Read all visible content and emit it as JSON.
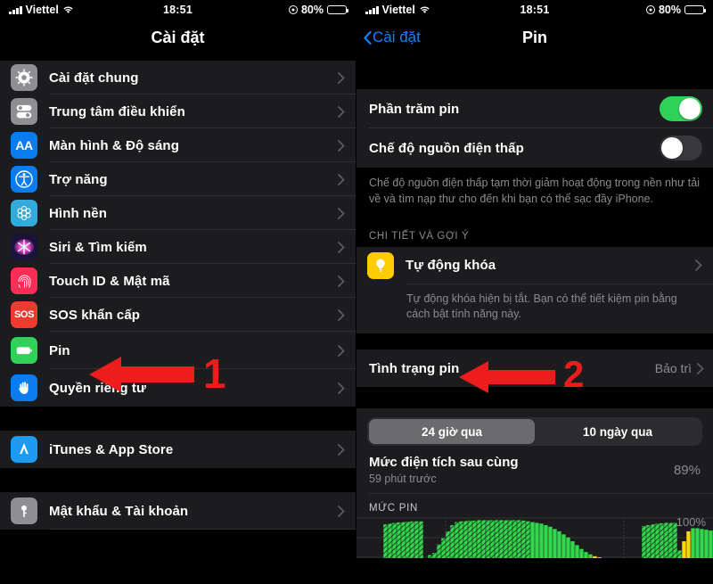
{
  "status_bar": {
    "carrier": "Viettel",
    "time": "18:51",
    "battery_percent": "80%",
    "wifi_icon": "wifi-icon",
    "signal_icon": "cellular-signal-icon",
    "location_icon": "location-services-icon",
    "battery_icon": "battery-icon"
  },
  "left_screen": {
    "nav_title": "Cài đặt",
    "groups": [
      {
        "items": [
          {
            "label": "Cài đặt chung",
            "icon": "gear-icon"
          },
          {
            "label": "Trung tâm điều khiển",
            "icon": "control-center-icon"
          },
          {
            "label": "Màn hình & Độ sáng",
            "icon": "display-brightness-icon"
          },
          {
            "label": "Trợ năng",
            "icon": "accessibility-icon"
          },
          {
            "label": "Hình nền",
            "icon": "wallpaper-icon"
          },
          {
            "label": "Siri & Tìm kiếm",
            "icon": "siri-icon"
          },
          {
            "label": "Touch ID & Mật mã",
            "icon": "touch-id-icon"
          },
          {
            "label": "SOS khẩn cấp",
            "icon": "sos-icon"
          },
          {
            "label": "Pin",
            "icon": "battery-green-icon"
          },
          {
            "label": "Quyền riêng tư",
            "icon": "privacy-hand-icon"
          }
        ]
      },
      {
        "items": [
          {
            "label": "iTunes & App Store",
            "icon": "app-store-icon"
          }
        ]
      },
      {
        "items": [
          {
            "label": "Mật khẩu & Tài khoản",
            "icon": "key-icon"
          }
        ]
      }
    ]
  },
  "right_screen": {
    "back_label": "Cài đặt",
    "nav_title": "Pin",
    "battery_percentage_label": "Phần trăm pin",
    "battery_percentage_on": true,
    "low_power_label": "Chế độ nguồn điện thấp",
    "low_power_on": false,
    "low_power_help": "Chế độ nguồn điện thấp tạm thời giảm hoạt động trong nền như tải về và tìm nạp thư cho đến khi bạn có thể sạc đầy iPhone.",
    "insights_header": "CHI TIẾT VÀ GỢI Ý",
    "auto_lock_label": "Tự động khóa",
    "auto_lock_icon": "lightbulb-icon",
    "auto_lock_help": "Tự động khóa hiện bị tắt. Bạn có thể tiết kiệm pin bằng cách bật tính năng này.",
    "battery_health_label": "Tình trạng pin",
    "battery_health_value": "Bảo trì",
    "segments": [
      {
        "label": "24 giờ qua",
        "active": true
      },
      {
        "label": "10 ngày qua",
        "active": false
      }
    ],
    "last_charge_title": "Mức điện tích sau cùng",
    "last_charge_sub": "59 phút trước",
    "last_charge_value": "89%",
    "chart_label": "MỨC PIN",
    "chart_max_label": "100%"
  },
  "annotations": [
    {
      "number": "1",
      "color": "#ee1c1c",
      "target": "pin-row"
    },
    {
      "number": "2",
      "color": "#ee1c1c",
      "target": "battery-health-row"
    }
  ],
  "chart_data": {
    "type": "bar",
    "title": "MỨC PIN",
    "ylabel": "",
    "xlabel": "",
    "ylim": [
      0,
      100
    ],
    "max_label": "100%",
    "grid": true,
    "legend": null,
    "bar_color": "#32d74b",
    "charge_color": "#ffd60a",
    "values": [
      0,
      0,
      0,
      0,
      0,
      0,
      0,
      0,
      0,
      0,
      0,
      0,
      0,
      0,
      0,
      0,
      0,
      0,
      0,
      0,
      0,
      0,
      0,
      0,
      0,
      0,
      0,
      0,
      0,
      0,
      0,
      0,
      0,
      0,
      0,
      0,
      0,
      0,
      0,
      0,
      0,
      0,
      0,
      0,
      0,
      0,
      0,
      0,
      0,
      0,
      0,
      0,
      0,
      0,
      0,
      0,
      0,
      0,
      0,
      0
    ],
    "series": [
      {
        "name": "Mức pin",
        "values": [
          0,
          0,
          0,
          0,
          0,
          0,
          88,
          90,
          92,
          93,
          94,
          95,
          96,
          96,
          96,
          0,
          8,
          14,
          36,
          52,
          70,
          86,
          94,
          96,
          97,
          98,
          98,
          99,
          99,
          99,
          99,
          99,
          99,
          99,
          99,
          99,
          99,
          98,
          96,
          94,
          92,
          90,
          86,
          82,
          76,
          70,
          62,
          54,
          44,
          34,
          24,
          16,
          10,
          5,
          2,
          0,
          0,
          0,
          0,
          0,
          0,
          0,
          0,
          0,
          84,
          86,
          88,
          90,
          91,
          92,
          92,
          92,
          20,
          44,
          70,
          78,
          78,
          76,
          74,
          72
        ]
      }
    ]
  }
}
